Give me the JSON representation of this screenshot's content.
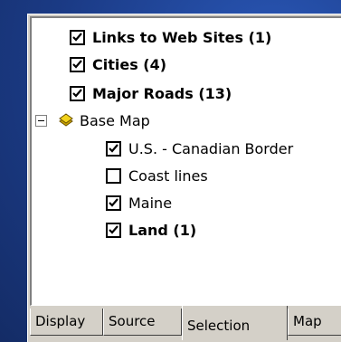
{
  "layers": [
    {
      "label": "Links to Web Sites (1)",
      "checked": true,
      "bold": true
    },
    {
      "label": "Cities (4)",
      "checked": true,
      "bold": true
    },
    {
      "label": "Major Roads (13)",
      "checked": true,
      "bold": true
    }
  ],
  "group": {
    "label": "Base Map",
    "expanded": true,
    "icon": "layer-group-icon",
    "children": [
      {
        "label": "U.S. - Canadian Border",
        "checked": true,
        "bold": false
      },
      {
        "label": "Coast lines",
        "checked": false,
        "bold": false
      },
      {
        "label": "Maine",
        "checked": true,
        "bold": false
      },
      {
        "label": "Land (1)",
        "checked": true,
        "bold": true
      }
    ]
  },
  "tabs": [
    "Display",
    "Source",
    "Selection",
    "Map"
  ],
  "active_tab": "Selection",
  "colors": {
    "background": "#1c3f8c",
    "panel": "#d4d0c8",
    "tree_background": "#ffffff",
    "icon_yellow": "#f2d21a"
  }
}
